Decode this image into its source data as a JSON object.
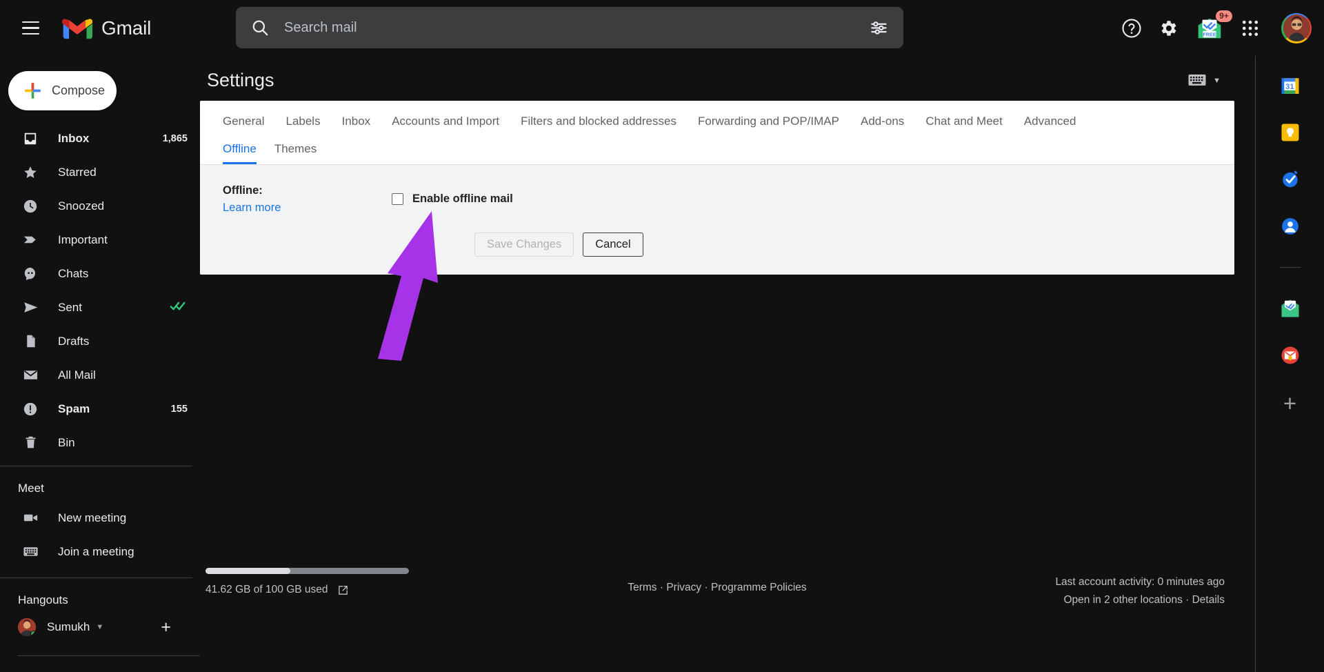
{
  "app": {
    "brand": "Gmail",
    "menu_icon": "hamburger-menu-icon",
    "logo_icon": "gmail-logo-icon"
  },
  "search": {
    "placeholder": "Search mail",
    "value": "",
    "icon": "search-icon",
    "options_icon": "tune-options-icon"
  },
  "header_actions": [
    {
      "name": "support-icon",
      "label": "Support"
    },
    {
      "name": "settings-gear-icon",
      "label": "Settings"
    },
    {
      "name": "mailtrack-icon",
      "label": "Mailtrack",
      "badge": "9+",
      "sub_label": "FREE"
    },
    {
      "name": "google-apps-icon",
      "label": "Google apps"
    },
    {
      "name": "account-avatar",
      "label": "Google Account"
    }
  ],
  "sidebar": {
    "compose_label": "Compose",
    "compose_icon": "plus-compose-icon",
    "items": [
      {
        "label": "Inbox",
        "icon": "inbox-icon",
        "count": "1,865",
        "bold": true
      },
      {
        "label": "Starred",
        "icon": "star-icon",
        "count": "",
        "bold": false
      },
      {
        "label": "Snoozed",
        "icon": "clock-icon",
        "count": "",
        "bold": false
      },
      {
        "label": "Important",
        "icon": "important-icon",
        "count": "",
        "bold": false
      },
      {
        "label": "Chats",
        "icon": "chat-icon",
        "count": "",
        "bold": false
      },
      {
        "label": "Sent",
        "icon": "send-icon",
        "count": "",
        "bold": false,
        "trailing_icon": "double-check-icon"
      },
      {
        "label": "Drafts",
        "icon": "draft-icon",
        "count": "",
        "bold": false
      },
      {
        "label": "All Mail",
        "icon": "all-mail-icon",
        "count": "",
        "bold": false
      },
      {
        "label": "Spam",
        "icon": "spam-icon",
        "count": "155",
        "bold": true
      },
      {
        "label": "Bin",
        "icon": "trash-icon",
        "count": "",
        "bold": false
      }
    ],
    "meet": {
      "heading": "Meet",
      "items": [
        {
          "label": "New meeting",
          "icon": "video-camera-icon"
        },
        {
          "label": "Join a meeting",
          "icon": "keyboard-icon"
        }
      ]
    },
    "hangouts": {
      "heading": "Hangouts",
      "user_name": "Sumukh",
      "caret_icon": "chevron-down-icon",
      "add_icon": "plus-icon"
    }
  },
  "main": {
    "page_title": "Settings",
    "keyboard_control_icon": "keyboard-icon",
    "keyboard_caret_icon": "chevron-down-icon",
    "tabs": [
      {
        "label": "General",
        "active": false
      },
      {
        "label": "Labels",
        "active": false
      },
      {
        "label": "Inbox",
        "active": false
      },
      {
        "label": "Accounts and Import",
        "active": false
      },
      {
        "label": "Filters and blocked addresses",
        "active": false
      },
      {
        "label": "Forwarding and POP/IMAP",
        "active": false
      },
      {
        "label": "Add-ons",
        "active": false
      },
      {
        "label": "Chat and Meet",
        "active": false
      },
      {
        "label": "Advanced",
        "active": false
      }
    ],
    "subtabs": [
      {
        "label": "Offline",
        "active": true
      },
      {
        "label": "Themes",
        "active": false
      }
    ],
    "offline_panel": {
      "section_label": "Offline:",
      "learn_more_label": "Learn more",
      "checkbox_label": "Enable offline mail",
      "checkbox_checked": false,
      "save_label": "Save Changes",
      "save_disabled": true,
      "cancel_label": "Cancel"
    }
  },
  "footer": {
    "storage_used_percent": 41.62,
    "storage_text": "41.62 GB of 100 GB used",
    "storage_link_icon": "external-link-icon",
    "legal_links": [
      "Terms",
      "Privacy",
      "Programme Policies"
    ],
    "legal_separator": "·",
    "last_activity": "Last account activity: 0 minutes ago",
    "open_locations": "Open in 2 other locations",
    "details_label": "Details",
    "activity_separator": "·"
  },
  "right_rail": [
    {
      "name": "google-calendar-icon",
      "label": "Calendar"
    },
    {
      "name": "google-keep-icon",
      "label": "Keep"
    },
    {
      "name": "google-tasks-icon",
      "label": "Tasks"
    },
    {
      "name": "google-contacts-icon",
      "label": "Contacts"
    },
    {
      "name": "mailtrack-addon-icon",
      "label": "Mailtrack"
    },
    {
      "name": "boomerang-addon-icon",
      "label": "Boomerang"
    },
    {
      "name": "get-addons-icon",
      "label": "Get add-ons"
    }
  ],
  "annotation": {
    "arrow_color": "#a733e8",
    "points_to": "Enable offline mail checkbox"
  }
}
